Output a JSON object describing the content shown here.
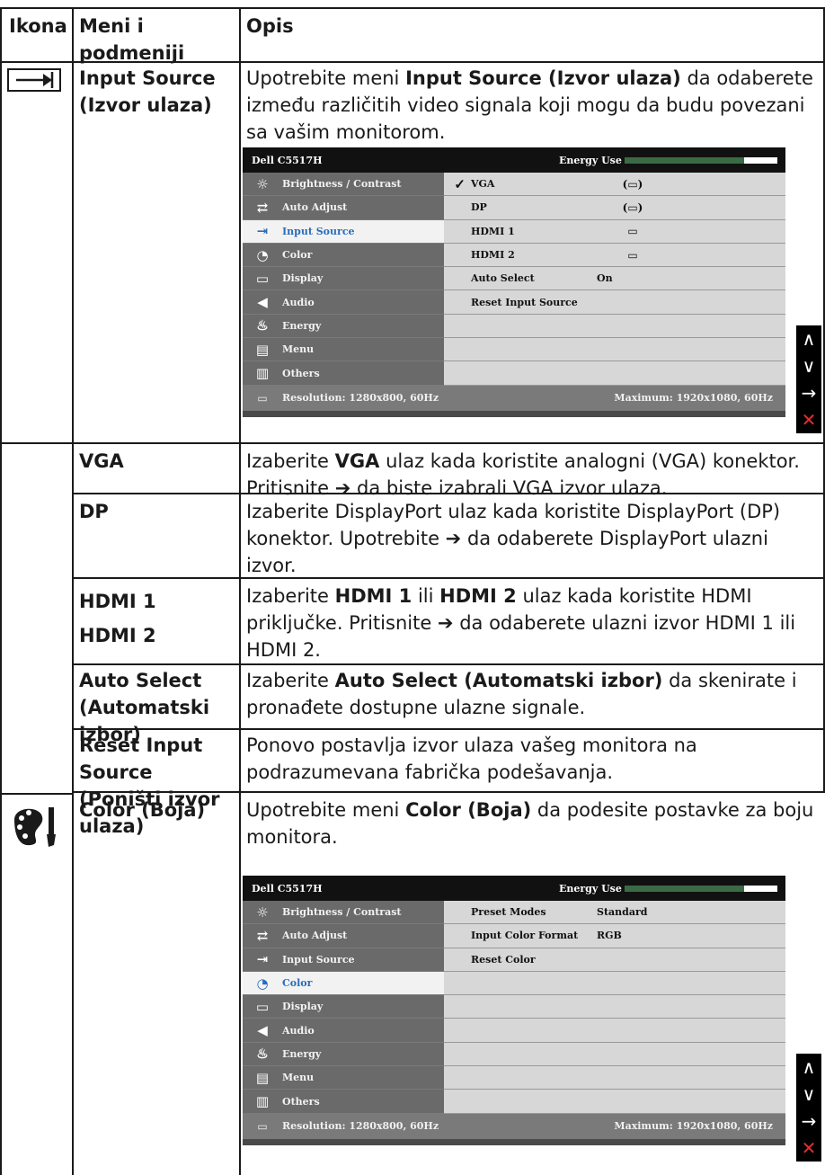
{
  "header": {
    "col_icon": "Ikona",
    "col_menu": "Meni i podmeniji",
    "col_desc": "Opis"
  },
  "input_source": {
    "menu": "Input Source (Izvor ulaza)",
    "desc_a": "Upotrebite meni ",
    "desc_bold": "Input Source (Izvor ulaza)",
    "desc_b": " da odaberete između različitih video signala koji mogu da budu povezani sa vašim monitorom."
  },
  "osd1": {
    "model": "Dell C5517H",
    "energy_label": "Energy Use",
    "energy_fill": 0.78,
    "left_items": [
      {
        "icon": "brightness-icon",
        "glyph": "☼",
        "label": "Brightness / Contrast"
      },
      {
        "icon": "auto-adjust-icon",
        "glyph": "⇄",
        "label": "Auto Adjust"
      },
      {
        "icon": "input-source-icon",
        "glyph": "⇥",
        "label": "Input Source"
      },
      {
        "icon": "color-icon",
        "glyph": "◔",
        "label": "Color"
      },
      {
        "icon": "display-icon",
        "glyph": "▭",
        "label": "Display"
      },
      {
        "icon": "audio-icon",
        "glyph": "◀",
        "label": "Audio"
      },
      {
        "icon": "energy-icon",
        "glyph": "♨",
        "label": "Energy"
      },
      {
        "icon": "menu-icon",
        "glyph": "▤",
        "label": "Menu"
      },
      {
        "icon": "others-icon",
        "glyph": "▥",
        "label": "Others"
      }
    ],
    "selected_index": 2,
    "right_items": [
      {
        "check": "✓",
        "name": "VGA",
        "value": "",
        "conn": "(▭)"
      },
      {
        "check": "",
        "name": "DP",
        "value": "",
        "conn": "(▭)"
      },
      {
        "check": "",
        "name": "HDMI 1",
        "value": "",
        "conn": "▭"
      },
      {
        "check": "",
        "name": "HDMI 2",
        "value": "",
        "conn": "▭"
      },
      {
        "check": "",
        "name": "Auto Select",
        "value": "On",
        "conn": ""
      },
      {
        "check": "",
        "name": "Reset Input Source",
        "value": "",
        "conn": ""
      },
      {
        "check": "",
        "name": "",
        "value": "",
        "conn": ""
      },
      {
        "check": "",
        "name": "",
        "value": "",
        "conn": ""
      },
      {
        "check": "",
        "name": "",
        "value": "",
        "conn": ""
      }
    ],
    "resolution": "Resolution: 1280x800, 60Hz",
    "maximum": "Maximum: 1920x1080, 60Hz"
  },
  "rows": {
    "vga": {
      "menu": "VGA",
      "d1": "Izaberite ",
      "d1b": "VGA",
      "d1c": " ulaz kada koristite analogni (VGA) konektor.",
      "d2": "Pritisnite ",
      "d2c": " da biste izabrali VGA izvor ulaza."
    },
    "dp": {
      "menu": "DP",
      "d1": "Izaberite DisplayPort ulaz kada koristite DisplayPort (DP) konektor. Upotrebite ",
      "d2": " da odaberete DisplayPort ulazni izvor."
    },
    "hdmi": {
      "menu1": "HDMI 1",
      "menu2": "HDMI 2",
      "d1": "Izaberite ",
      "d1b": "HDMI 1",
      "d1c": " ili ",
      "d1d": "HDMI 2",
      "d1e": " ulaz kada koristite HDMI priključke. Pritisnite ",
      "d2": " da odaberete ulazni izvor HDMI 1 ili HDMI 2."
    },
    "auto": {
      "menu": "Auto Select (Automatski izbor)",
      "d1": "Izaberite ",
      "d1b": "Auto Select (Automatski izbor)",
      "d1c": " da skenirate i pronađete dostupne ulazne signale."
    },
    "reset": {
      "menu": "Reset Input Source (Poništi izvor ulaza)",
      "d1": "Ponovo postavlja izvor ulaza vašeg monitora na podrazumevana fabrička podešavanja."
    },
    "color": {
      "menu": "Color (Boja)",
      "d1": "Upotrebite meni ",
      "d1b": "Color (Boja)",
      "d1c": " da podesite postavke za boju monitora."
    }
  },
  "osd2": {
    "model": "Dell C5517H",
    "energy_label": "Energy Use",
    "energy_fill": 0.78,
    "selected_index": 3,
    "right_items": [
      {
        "check": "",
        "name": "Preset Modes",
        "value": "Standard",
        "conn": ""
      },
      {
        "check": "",
        "name": "Input Color Format",
        "value": "RGB",
        "conn": ""
      },
      {
        "check": "",
        "name": "Reset Color",
        "value": "",
        "conn": ""
      },
      {
        "check": "",
        "name": "",
        "value": "",
        "conn": ""
      },
      {
        "check": "",
        "name": "",
        "value": "",
        "conn": ""
      },
      {
        "check": "",
        "name": "",
        "value": "",
        "conn": ""
      },
      {
        "check": "",
        "name": "",
        "value": "",
        "conn": ""
      },
      {
        "check": "",
        "name": "",
        "value": "",
        "conn": ""
      },
      {
        "check": "",
        "name": "",
        "value": "",
        "conn": ""
      }
    ],
    "resolution": "Resolution: 1280x800, 60Hz",
    "maximum": "Maximum: 1920x1080, 60Hz"
  },
  "keys": {
    "up": "∧",
    "down": "∨",
    "right": "→",
    "exit": "✕"
  },
  "arrow_glyph": "➔"
}
